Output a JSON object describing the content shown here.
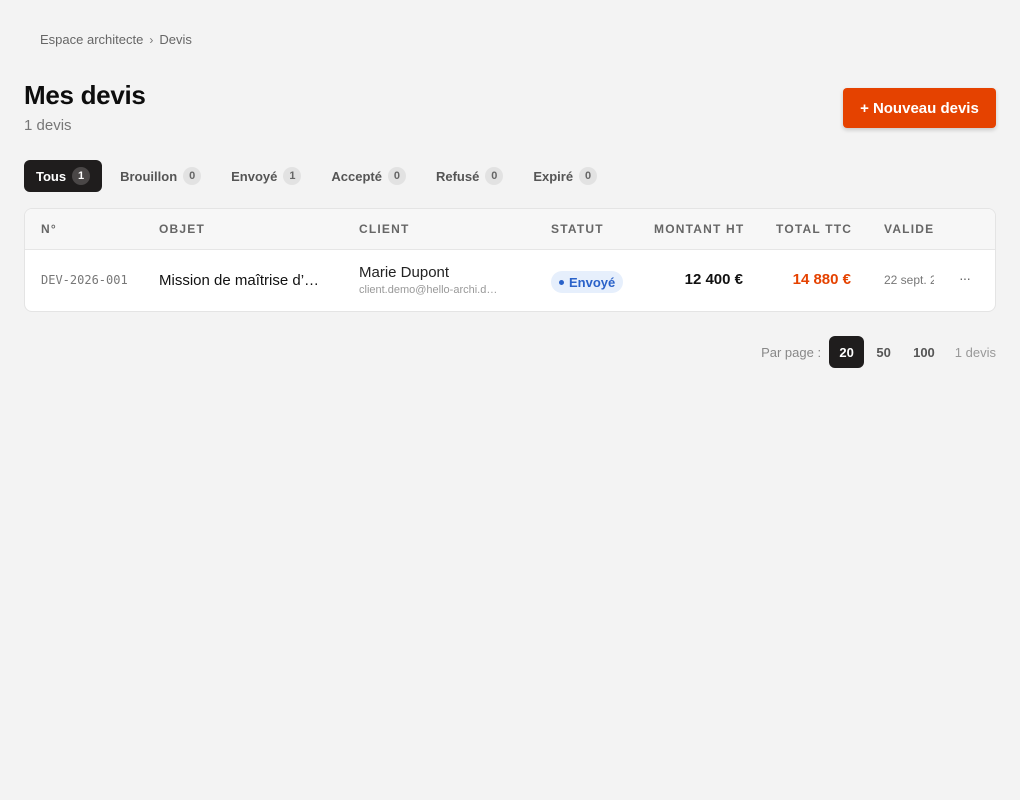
{
  "breadcrumb": {
    "root": "Espace architecte",
    "separator": "›",
    "current": "Devis"
  },
  "header": {
    "title": "Mes devis",
    "count": "1 devis",
    "new_button_icon": "+",
    "new_button_label": "Nouveau devis"
  },
  "tabs": [
    {
      "label": "Tous",
      "count": "1",
      "active": true
    },
    {
      "label": "Brouillon",
      "count": "0"
    },
    {
      "label": "Envoyé",
      "count": "1"
    },
    {
      "label": "Accepté",
      "count": "0"
    },
    {
      "label": "Refusé",
      "count": "0"
    },
    {
      "label": "Expiré",
      "count": "0"
    }
  ],
  "table": {
    "columns": [
      "N°",
      "OBJET",
      "CLIENT",
      "STATUT",
      "MONTANT HT",
      "TOTAL TTC",
      "VALIDE"
    ],
    "rows": [
      {
        "number": "DEV-2026-001",
        "object": "Mission de maîtrise d’…",
        "client_name": "Marie Dupont",
        "client_email": "client.demo@hello-archi.d…",
        "status": "Envoyé",
        "amount_ht": "12 400 €",
        "total_ttc": "14 880 €",
        "valid_until": "22 sept. 2",
        "more": "···"
      }
    ]
  },
  "pagination": {
    "label": "Par page :",
    "options": [
      "20",
      "50",
      "100"
    ],
    "selected": "20",
    "total": "1 devis"
  },
  "colors": {
    "accent": "#e54200",
    "status_sent_bg": "#e6effc",
    "status_sent_text": "#2a62c9",
    "active_tab": "#1f1d1d"
  }
}
